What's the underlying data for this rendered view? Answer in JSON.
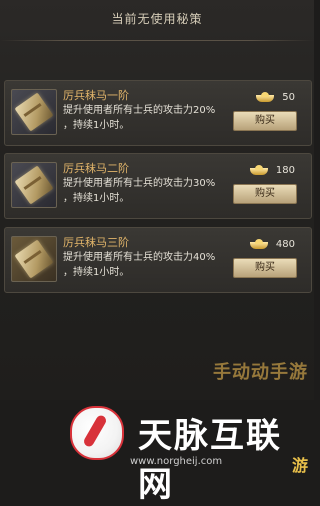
{
  "panel": {
    "title": "当前无使用秘策"
  },
  "cards": [
    {
      "name": "厉兵秣马一阶",
      "desc_line1": "提升使用者所有士兵的攻击力20%",
      "desc_line2": "，持续1小时。",
      "price": "50",
      "buy": "购买"
    },
    {
      "name": "厉兵秣马二阶",
      "desc_line1": "提升使用者所有士兵的攻击力30%",
      "desc_line2": "，持续1小时。",
      "price": "180",
      "buy": "购买"
    },
    {
      "name": "厉兵秣马三阶",
      "desc_line1": "提升使用者所有士兵的攻击力40%",
      "desc_line2": "，持续1小时。",
      "price": "480",
      "buy": "购买"
    }
  ],
  "watermark": {
    "brand": "天脉互联网",
    "url": "www.norgheij.com",
    "side_text": "手动动手游",
    "bottom_text": "游"
  }
}
